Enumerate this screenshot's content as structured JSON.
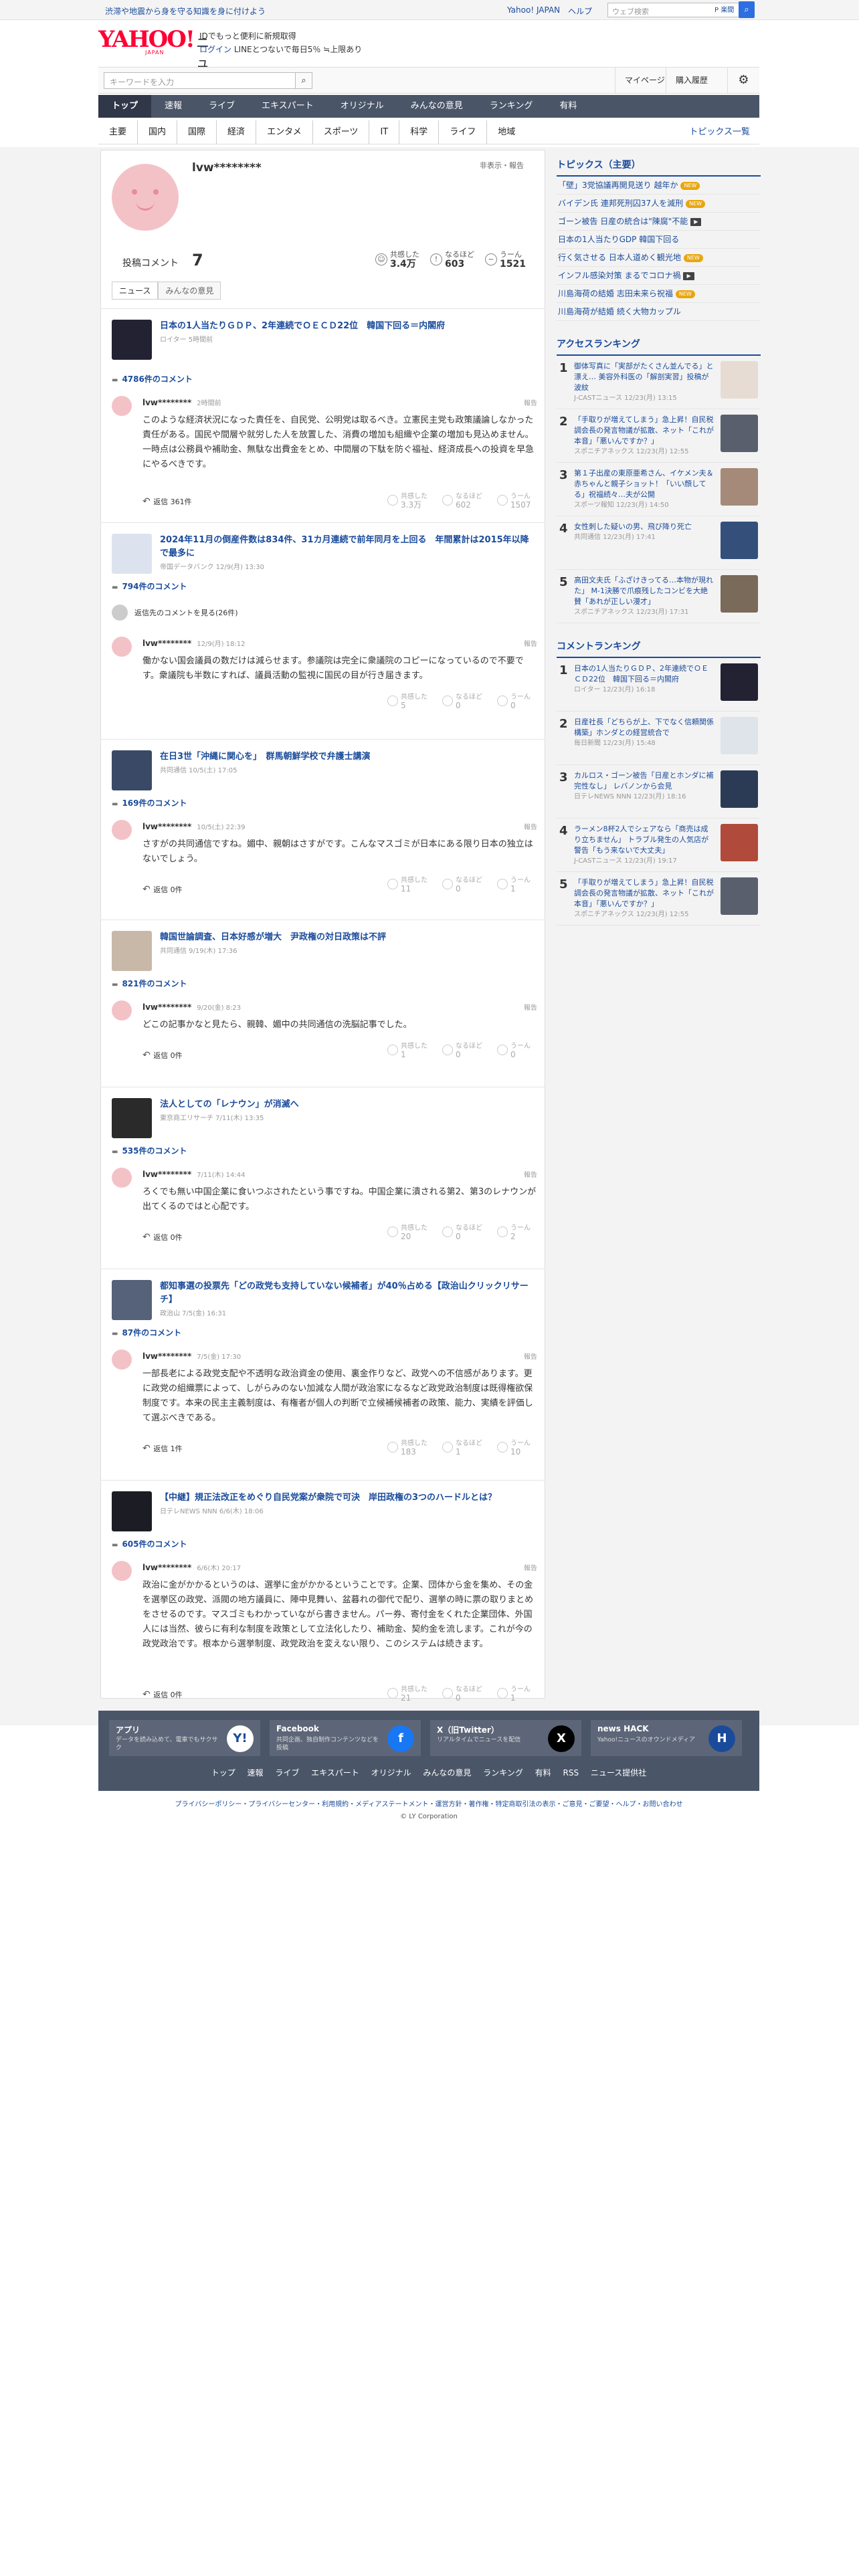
{
  "topbar": {
    "promo": "渋滞や地震から身を守る知識を身に付けよう",
    "links": [
      "Yahoo! JAPAN",
      "ヘルプ"
    ],
    "search_placeholder": "ウェブ検索",
    "search_btn": "P 楽間"
  },
  "header": {
    "logo": "YAHOO!",
    "logo_sub": "JAPAN",
    "service": "ニュース",
    "info1": "IDでもっと便利に新規取得",
    "login": "ログイン",
    "info2": "LINEとつないで毎日5％ ≒上限あり"
  },
  "search": {
    "placeholder": "キーワードを入力",
    "mypage": "マイページ",
    "history": "購入履歴"
  },
  "mainnav": [
    "トップ",
    "速報",
    "ライブ",
    "エキスパート",
    "オリジナル",
    "みんなの意見",
    "ランキング",
    "有料"
  ],
  "subnav": [
    "主要",
    "国内",
    "国際",
    "経済",
    "エンタメ",
    "スポーツ",
    "IT",
    "科学",
    "ライフ",
    "地域"
  ],
  "subnav_all": "トピックス一覧",
  "profile": {
    "name": "lvw********",
    "hide": "非表示・報告",
    "posts_label": "投稿コメント",
    "posts": "7",
    "empathy_label": "共感した",
    "empathy": "3.4万",
    "naruhodo_label": "なるほど",
    "naruhodo": "603",
    "uun_label": "うーん",
    "uun": "1521"
  },
  "tabs": [
    "ニュース",
    "みんなの意見"
  ],
  "articles": [
    {
      "title": "日本の1人当たりＧＤＰ、2年連続でＯＥＣＤ22位　韓国下回る＝内閣府",
      "src": "ロイター 5時間前",
      "ccount": "4786件のコメント",
      "user": "lvw********",
      "date": "2時間前",
      "report": "報告",
      "text": "このような経済状況になった責任を、自民党、公明党は取るべき。立憲民主党も政策議論しなかった責任がある。国民や間層や就労した人を放置した、消費の増加も組織や企業の増加も見込めません。一時点は公務員や補助金、無駄な出費金をとめ、中間層の下駄を防ぐ福祉、経済成長への投資を早急にやるべきです。",
      "reply": "返信 361件",
      "v1": "3.3万",
      "v2": "602",
      "v3": "1507"
    },
    {
      "title": "2024年11月の倒産件数は834件、31カ月連続で前年同月を上回る　年間累計は2015年以降で最多に",
      "src": "帝国データバンク 12/9(月) 13:30",
      "ccount": "794件のコメント",
      "parent": "返信先のコメントを見る(26件)",
      "user": "lvw********",
      "date": "12/9(月) 18:12",
      "report": "報告",
      "text": "働かない国会議員の数だけは減らせます。参議院は完全に衆議院のコピーになっているので不要です。衆議院も半数にすれば、議員活動の監視に国民の目が行き届きます。",
      "reply": "",
      "v1": "5",
      "v2": "0",
      "v3": "0"
    },
    {
      "title": "在日3世「沖縄に関心を」　群馬朝鮮学校で弁護士講演",
      "src": "共同通信 10/5(土) 17:05",
      "ccount": "169件のコメント",
      "user": "lvw********",
      "date": "10/5(土) 22:39",
      "report": "報告",
      "text": "さすがの共同通信ですね。媚中、親朝はさすがです。こんなマスゴミが日本にある限り日本の独立はないでしょう。",
      "reply": "返信 0件",
      "v1": "11",
      "v2": "0",
      "v3": "1"
    },
    {
      "title": "韓国世論調査、日本好感が増大　尹政権の対日政策は不評",
      "src": "共同通信 9/19(木) 17:36",
      "ccount": "821件のコメント",
      "user": "lvw********",
      "date": "9/20(金) 8:23",
      "report": "報告",
      "text": "どこの記事かなと見たら、親韓、媚中の共同通信の洗脳記事でした。",
      "reply": "返信 0件",
      "v1": "1",
      "v2": "0",
      "v3": "0"
    },
    {
      "title": "法人としての「レナウン」が消滅へ",
      "src": "東京商工リサーチ 7/11(木) 13:35",
      "ccount": "535件のコメント",
      "user": "lvw********",
      "date": "7/11(木) 14:44",
      "report": "報告",
      "text": "ろくでも無い中国企業に食いつぶされたという事ですね。中国企業に潰される第2、第3のレナウンが出てくるのではと心配です。",
      "reply": "返信 0件",
      "v1": "20",
      "v2": "0",
      "v3": "2"
    },
    {
      "title": "都知事選の投票先「どの政党も支持していない候補者」が40％占める【政治山クリックリサーチ】",
      "src": "政治山 7/5(金) 16:31",
      "ccount": "87件のコメント",
      "user": "lvw********",
      "date": "7/5(金) 17:30",
      "report": "報告",
      "text": "一部長老による政党支配や不透明な政治資金の使用、裏金作りなど、政党への不信感があります。更に政党の組織票によって、しがらみのない加減な人間が政治家になるなど政党政治制度は既得権欲保制度です。本来の民主主義制度は、有権者が個人の判断で立候補候補者の政策、能力、実績を評価して選ぶべきである。",
      "reply": "返信 1件",
      "v1": "183",
      "v2": "1",
      "v3": "10"
    },
    {
      "title": "【中継】規正法改正をめぐり自民党案が衆院で可決　岸田政権の3つのハードルとは？",
      "src": "日テレNEWS NNN 6/6(木) 18:06",
      "ccount": "605件のコメント",
      "user": "lvw********",
      "date": "6/6(木) 20:17",
      "report": "報告",
      "text": "政治に金がかかるというのは、選挙に金がかかるということです。企業、団体から金を集め、その金を選挙区の政党、派閥の地方議員に、陣中見舞い、盆暮れの御代で配り、選挙の時に票の取りまとめをさせるのです。マスゴミもわかっていながら書きません。パー券、寄付金をくれた企業団体、外国人には当然、彼らに有利な制度を政策として立法化したり、補助金、契約金を流します。これが今の政党政治です。根本から選挙制度、政党政治を変えない限り、このシステムは続きます。",
      "reply": "返信 0件",
      "v1": "21",
      "v2": "0",
      "v3": "1"
    }
  ],
  "topics": {
    "title": "トピックス（主要）",
    "items": [
      {
        "t": "「壁」3党協議再開見送り 越年か",
        "tag": "NEW"
      },
      {
        "t": "バイデン氏 連邦死刑囚37人を減刑",
        "tag": "NEW"
      },
      {
        "t": "ゴーン被告 日産の統合は\"陳腐\"不能",
        "tag": "cam"
      },
      {
        "t": "日本の1人当たりGDP 韓国下回る",
        "tag": ""
      },
      {
        "t": "行く気させる 日本人道めく観光地",
        "tag": "NEW"
      },
      {
        "t": "インフル感染対策 まるでコロナ禍",
        "tag": "cam"
      },
      {
        "t": "川島海荷の結婚 志田未来ら祝福",
        "tag": "NEW"
      },
      {
        "t": "川島海荷が結婚 続く大物カップル",
        "tag": ""
      }
    ]
  },
  "access": {
    "title": "アクセスランキング",
    "items": [
      {
        "t": "御体写真に「実部がたくさん並んでる」と漂え… 美容外科医の「解剖実習」投稿が波紋",
        "s": "J-CASTニュース 12/23(月) 13:15"
      },
      {
        "t": "「手取りが増えてしまう」急上昇！自民税調会長の発言物議が拡散、ネット「これが本音」「悪いんですか？」",
        "s": "スポニチアネックス 12/23(月) 12:55"
      },
      {
        "t": "第１子出産の東原亜希さん、イケメン夫＆赤ちゃんと親子ショット！「いい顔してる」祝福続々…夫が公開",
        "s": "スポーツ報知 12/23(月) 14:50"
      },
      {
        "t": "女性刺した疑いの男、飛び降り死亡",
        "s": "共同通信 12/23(月) 17:41"
      },
      {
        "t": "高田文夫氏「ふざけきってる…本物が現れた」 M-1決勝で爪痕残したコンビを大絶賛「あれが正しい漫才」",
        "s": "スポニチアネックス 12/23(月) 17:31"
      }
    ]
  },
  "comment_rank": {
    "title": "コメントランキング",
    "items": [
      {
        "t": "日本の1人当たりＧＤＰ、2年連続でＯＥＣＤ22位　韓国下回る＝内閣府",
        "s": "ロイター 12/23(月) 16:18"
      },
      {
        "t": "日産社長「どちらが上、下でなく信頼関係構築」ホンダとの経営統合で",
        "s": "毎日新聞 12/23(月) 15:48"
      },
      {
        "t": "カルロス・ゴーン被告「日産とホンダに補完性なし」 レバノンから会見",
        "s": "日テレNEWS NNN 12/23(月) 18:16"
      },
      {
        "t": "ラーメン8杯2人でシェアなら「商売は成り立ちません」 トラブル発生の人気店が警告「もう来ないで大丈夫」",
        "s": "J-CASTニュース 12/23(月) 19:17"
      },
      {
        "t": "「手取りが増えてしまう」急上昇！自民税調会長の発言物議が拡散、ネット「これが本音」「悪いんですか？」",
        "s": "スポニチアネックス 12/23(月) 12:55"
      }
    ]
  },
  "footer": {
    "boxes": [
      {
        "t": "アプリ",
        "d": "データを読み込めて、電車でもサクサク",
        "i": "Y!"
      },
      {
        "t": "Facebook",
        "d": "共同企画、独自制作コンテンツなどを投稿",
        "i": "f"
      },
      {
        "t": "X（旧Twitter）",
        "d": "リアルタイムでニュースを配信",
        "i": "X"
      },
      {
        "t": "news HACK",
        "d": "Yahoo!ニュースのオウンドメディア",
        "i": "H"
      }
    ],
    "nav": "トップ 速報 ライブ エキスパート オリジナル みんなの意見 ランキング 有料 RSS ニュース提供社",
    "legal": "プライバシーポリシー・プライバシーセンター・利用規約・メディアステートメント・運営方針・著作権・特定商取引法の表示・ご意見・ご要望・ヘルプ・お問い合わせ",
    "copy": "© LY Corporation"
  },
  "colors": {
    "brand": "#ff0033",
    "link": "#1a4b9b",
    "nav": "#4a5568"
  }
}
